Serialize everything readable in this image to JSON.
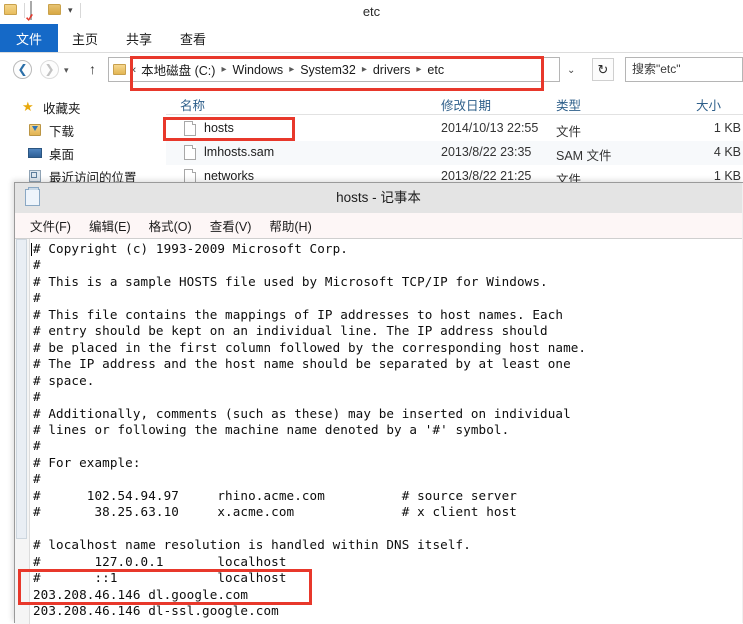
{
  "explorer": {
    "window_title": "etc",
    "quick_access": [
      {
        "name": "folder-icon-1",
        "label": ""
      },
      {
        "name": "new-folder-icon",
        "label": ""
      },
      {
        "name": "properties-icon",
        "label": ""
      },
      {
        "name": "customize-caret",
        "label": "▾"
      }
    ],
    "ribbon_tabs": [
      {
        "label": "文件",
        "active": true
      },
      {
        "label": "主页",
        "active": false
      },
      {
        "label": "共享",
        "active": false
      },
      {
        "label": "查看",
        "active": false
      }
    ],
    "nav": {
      "back": "❮",
      "forward": "❯",
      "history_caret": "▾",
      "up": "↑",
      "address_dropdown": "⌄",
      "refresh": "↻"
    },
    "breadcrumb": {
      "prefix": "«",
      "parts": [
        "本地磁盘 (C:)",
        "Windows",
        "System32",
        "drivers",
        "etc"
      ],
      "separator": "▸"
    },
    "search": {
      "placeholder": "搜索\"etc\"",
      "value": "搜索\"etc\""
    },
    "sidebar": {
      "items": [
        {
          "label": "收藏夹",
          "icon": "star-icon"
        },
        {
          "label": "下载",
          "icon": "downloads-folder-icon"
        },
        {
          "label": "桌面",
          "icon": "desktop-icon"
        },
        {
          "label": "最近访问的位置",
          "icon": "recent-places-icon"
        }
      ]
    },
    "columns": [
      "名称",
      "修改日期",
      "类型",
      "大小"
    ],
    "files": [
      {
        "name": "hosts",
        "date": "2014/10/13 22:55",
        "type": "文件",
        "size": "1 KB"
      },
      {
        "name": "lmhosts.sam",
        "date": "2013/8/22 23:35",
        "type": "SAM 文件",
        "size": "4 KB"
      },
      {
        "name": "networks",
        "date": "2013/8/22 21:25",
        "type": "文件",
        "size": "1 KB"
      }
    ]
  },
  "notepad": {
    "title": "hosts - 记事本",
    "menu": [
      "文件(F)",
      "编辑(E)",
      "格式(O)",
      "查看(V)",
      "帮助(H)"
    ],
    "content": "# Copyright (c) 1993-2009 Microsoft Corp.\n#\n# This is a sample HOSTS file used by Microsoft TCP/IP for Windows.\n#\n# This file contains the mappings of IP addresses to host names. Each\n# entry should be kept on an individual line. The IP address should\n# be placed in the first column followed by the corresponding host name.\n# The IP address and the host name should be separated by at least one\n# space.\n#\n# Additionally, comments (such as these) may be inserted on individual\n# lines or following the machine name denoted by a '#' symbol.\n#\n# For example:\n#\n#      102.54.94.97     rhino.acme.com          # source server\n#       38.25.63.10     x.acme.com              # x client host\n\n# localhost name resolution is handled within DNS itself.\n#       127.0.0.1       localhost\n#       ::1             localhost\n203.208.46.146 dl.google.com\n203.208.46.146 dl-ssl.google.com"
  },
  "annotations": {
    "color": "#e8382b",
    "boxes": [
      "address-bar",
      "hosts-file-row",
      "google-host-entries"
    ]
  }
}
